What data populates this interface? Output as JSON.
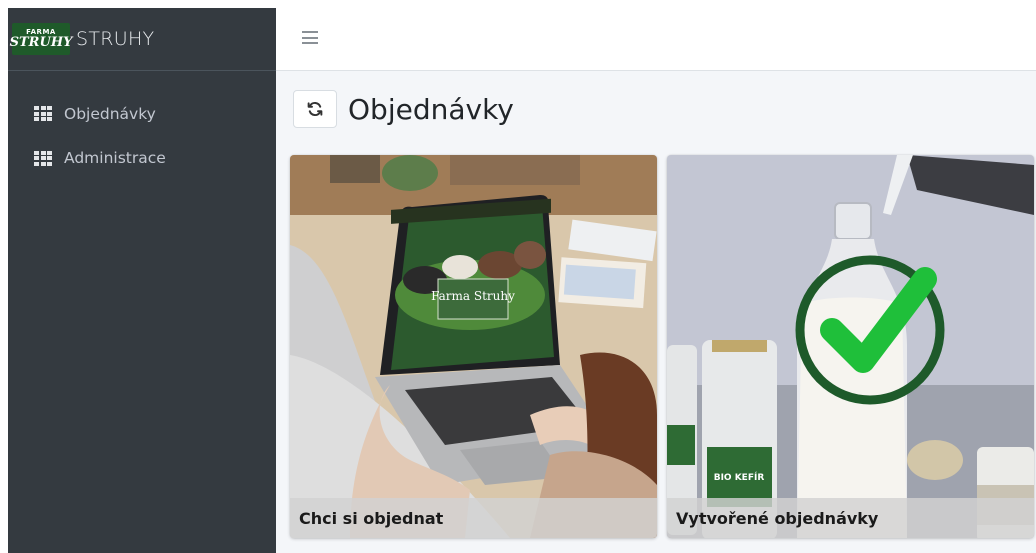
{
  "brand": {
    "logo_line1": "FARMA",
    "logo_line2": "STRUHY",
    "title": "STRUHY"
  },
  "sidebar": {
    "items": [
      {
        "label": "Objednávky",
        "icon": "grid-icon"
      },
      {
        "label": "Administrace",
        "icon": "grid-icon"
      }
    ]
  },
  "topbar": {
    "menu_icon": "hamburger-icon"
  },
  "main": {
    "title": "Objednávky",
    "refresh_icon": "refresh-icon",
    "cards": [
      {
        "caption": "Chci si objednat",
        "laptop_logo": "Farma Struhy"
      },
      {
        "caption": "Vytvořené objednávky",
        "jar_label": "BIO KEFÍR"
      }
    ]
  },
  "colors": {
    "sidebar_bg": "#343a40",
    "content_bg": "#f4f6f9",
    "brand_green": "#1f5a2a",
    "check_green": "#1fbf3a"
  }
}
